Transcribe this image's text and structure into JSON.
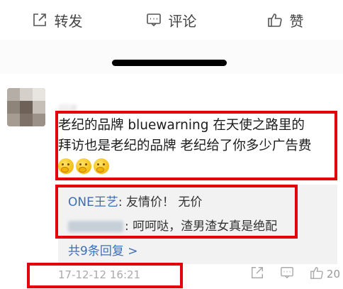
{
  "actions": {
    "forward_label": "转发",
    "comment_label": "评论",
    "like_label": "赞"
  },
  "comment": {
    "username": "闪还",
    "line1": "老纪的品牌  bluewarning   在天使之路里的",
    "line2": "拜访也是老纪的品牌  老纪给了你多少广告费",
    "emoji_icon": "thinking-face-icon",
    "timestamp": "17-12-12 16:21",
    "like_count": "20"
  },
  "replies": {
    "first_user": "ONE王艺",
    "first_text": ": 友情价！  无价",
    "second_text": ": 呵呵哒，渣男渣女真是绝配",
    "more_label": "共9条回复 >"
  },
  "colors": {
    "highlight_red": "#e3000b",
    "link_blue": "#3d6fb5"
  }
}
